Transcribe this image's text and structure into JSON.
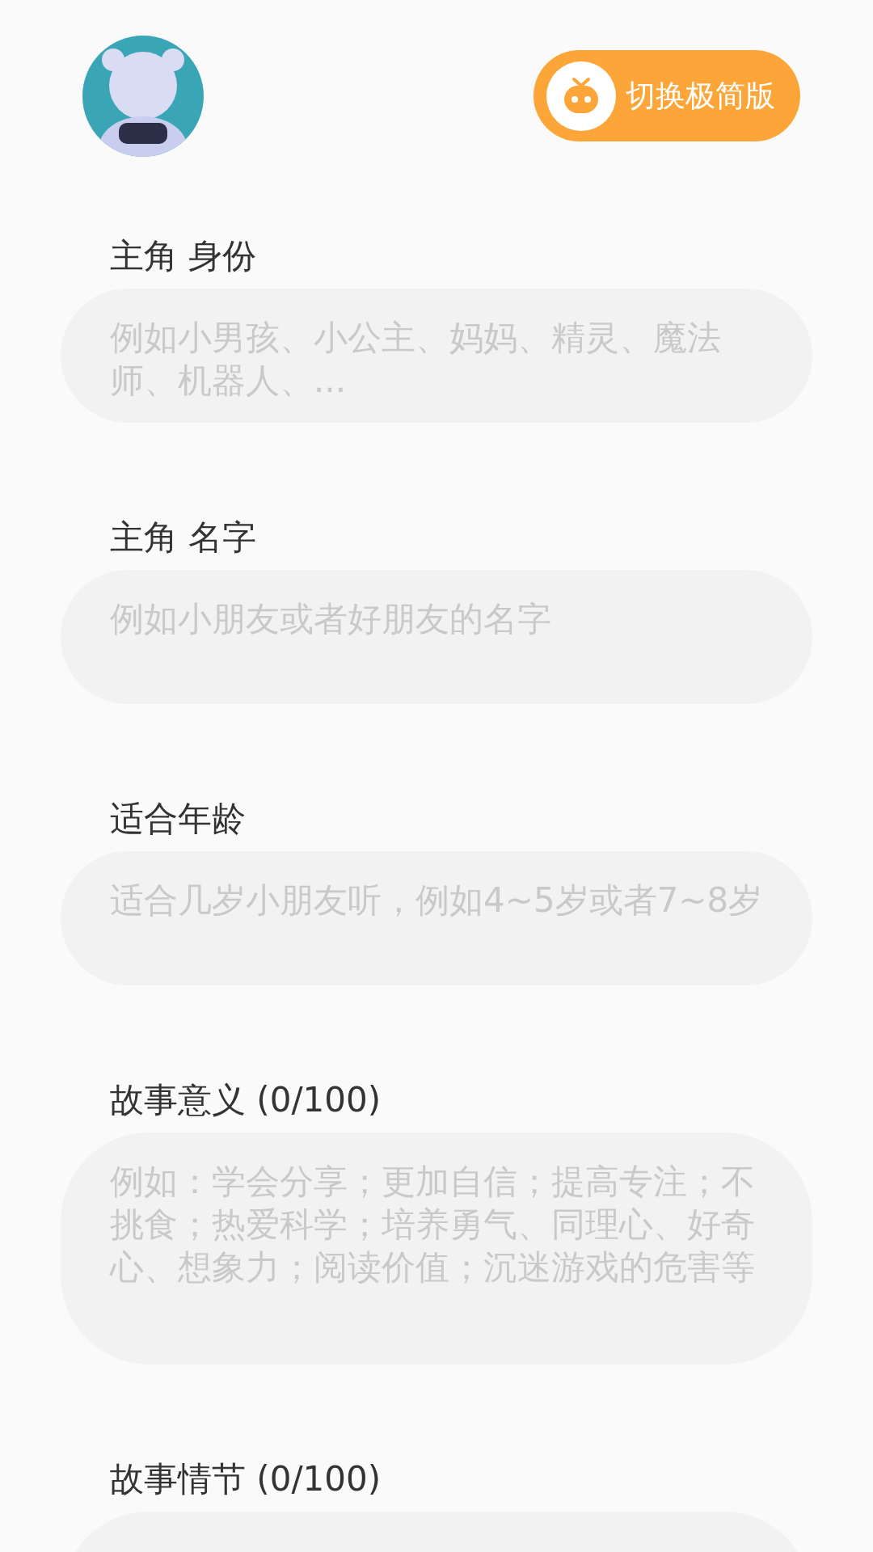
{
  "header": {
    "mode_button": {
      "label": "切换极简版"
    }
  },
  "fields": [
    {
      "label": "主角 身份",
      "kind": "input",
      "placeholder": "例如小男孩、小公主、妈妈、精灵、魔法师、机器人、..."
    },
    {
      "label": "主角 名字",
      "kind": "input",
      "placeholder": "例如小朋友或者好朋友的名字"
    },
    {
      "label": "适合年龄",
      "kind": "input",
      "placeholder": "适合几岁小朋友听，例如4~5岁或者7~8岁"
    },
    {
      "label": "故事意义 (0/100)",
      "kind": "textarea",
      "placeholder": "例如：学会分享；更加自信；提高专注；不挑食；热爱科学；培养勇气、同理心、好奇心、想象力；阅读价值；沉迷游戏的危害等"
    },
    {
      "label": "故事情节 (0/100)",
      "kind": "textarea"
    }
  ]
}
